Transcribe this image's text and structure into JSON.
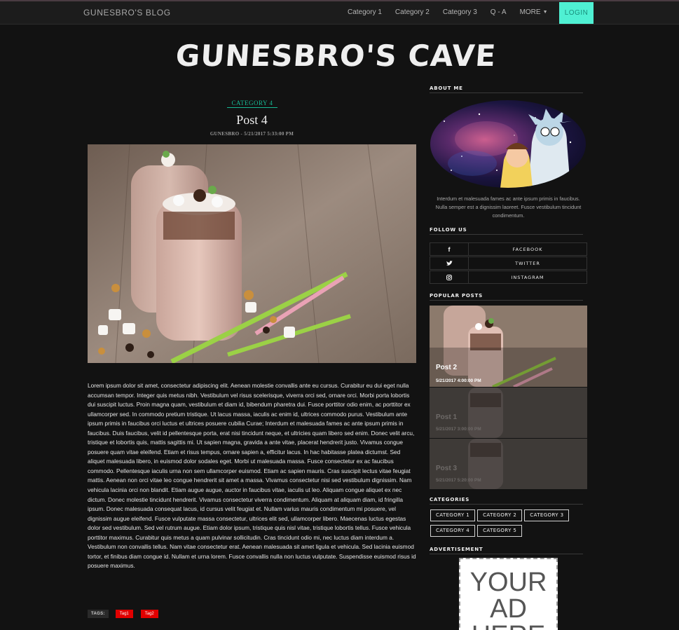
{
  "navbar": {
    "brand": "GUNESBRO'S BLOG",
    "links": [
      "Category 1",
      "Category 2",
      "Category 3",
      "Q - A",
      "MORE"
    ],
    "login": "LOGIN"
  },
  "site_title": "GUNESBRO'S CAVE",
  "post": {
    "category": "CATEGORY 4",
    "title": "Post 4",
    "meta": "GUNESBRO - 5/21/2017 5:33:00 PM",
    "body": "Lorem ipsum dolor sit amet, consectetur adipiscing elit. Aenean molestie convallis ante eu cursus. Curabitur eu dui eget nulla accumsan tempor. Integer quis metus nibh. Vestibulum vel risus scelerisque, viverra orci sed, ornare orci. Morbi porta lobortis dui suscipit luctus. Proin magna quam, vestibulum et diam id, bibendum pharetra dui. Fusce porttitor odio enim, ac porttitor ex ullamcorper sed. In commodo pretium tristique. Ut lacus massa, iaculis ac enim id, ultrices commodo purus. Vestibulum ante ipsum primis in faucibus orci luctus et ultrices posuere cubilia Curae; Interdum et malesuada fames ac ante ipsum primis in faucibus. Duis faucibus, velit id pellentesque porta, erat nisi tincidunt neque, et ultricies quam libero sed enim. Donec velit arcu, tristique et lobortis quis, mattis sagittis mi. Ut sapien magna, gravida a ante vitae, placerat hendrerit justo. Vivamus congue posuere quam vitae eleifend. Etiam et risus tempus, ornare sapien a, efficitur lacus. In hac habitasse platea dictumst. Sed aliquet malesuada libero, in euismod dolor sodales eget. Morbi ut malesuada massa. Fusce consectetur ex ac faucibus commodo. Pellentesque iaculis urna non sem ullamcorper euismod. Etiam ac sapien mauris. Cras suscipit lectus vitae feugiat mattis. Aenean non orci vitae leo congue hendrerit sit amet a massa. Vivamus consectetur nisi sed vestibulum dignissim. Nam vehicula lacinia orci non blandit. Etiam augue augue, auctor in faucibus vitae, iaculis ut leo. Aliquam congue aliquet ex nec dictum. Donec molestie tincidunt hendrerit. Vivamus consectetur viverra condimentum. Aliquam at aliquam diam, id fringilla ipsum. Donec malesuada consequat lacus, id cursus velit feugiat et. Nullam varius mauris condimentum mi posuere, vel dignissim augue eleifend. Fusce vulputate massa consectetur, ultrices elit sed, ullamcorper libero. Maecenas luctus egestas dolor sed vestibulum. Sed vel rutrum augue. Etiam dolor ipsum, tristique quis nisl vitae, tristique lobortis tellus. Fusce vehicula porttitor maximus. Curabitur quis metus a quam pulvinar sollicitudin. Cras tincidunt odio mi, nec luctus diam interdum a. Vestibulum non convallis tellus. Nam vitae consectetur erat. Aenean malesuada sit amet ligula et vehicula. Sed lacinia euismod tortor, et finibus diam congue id. Nullam et urna lorem. Fusce convallis nulla non luctus vulputate. Suspendisse euismod risus id posuere maximus.",
    "tags_label": "TAGS:",
    "tags": [
      "Tag1",
      "Tag2"
    ]
  },
  "sidebar": {
    "about_title": "ABOUT ME",
    "about_text": "Interdum et malesuada fames ac ante ipsum primis in faucibus. Nulla semper est a dignissim laoreet. Fusce vestibulum tincidunt condimentum.",
    "follow_title": "FOLLOW US",
    "social": [
      {
        "icon": "facebook-icon",
        "glyph": "f",
        "label": "FACEBOOK"
      },
      {
        "icon": "twitter-icon",
        "glyph": "t",
        "label": "TWITTER"
      },
      {
        "icon": "instagram-icon",
        "glyph": "◎",
        "label": "INSTAGRAM"
      }
    ],
    "popular_title": "POPULAR POSTS",
    "popular": [
      {
        "title": "Post 2",
        "date": "5/21/2017 4:00:00 PM"
      },
      {
        "title": "Post 1",
        "date": "5/21/2017 3:00:00 PM"
      },
      {
        "title": "Post 3",
        "date": "5/21/2017 5:20:00 PM"
      }
    ],
    "categories_title": "CATEGORIES",
    "categories": [
      "CATEGORY 1",
      "CATEGORY 2",
      "CATEGORY 3",
      "CATEGORY 4",
      "CATEGORY 5"
    ],
    "ad_title": "ADVERTISEMENT",
    "ad_text": [
      "YOUR",
      "AD",
      "HERE"
    ]
  },
  "colors": {
    "accent": "#4ff0d3",
    "category_link": "#17b894",
    "tag_red": "#e10000",
    "background": "#121212"
  }
}
